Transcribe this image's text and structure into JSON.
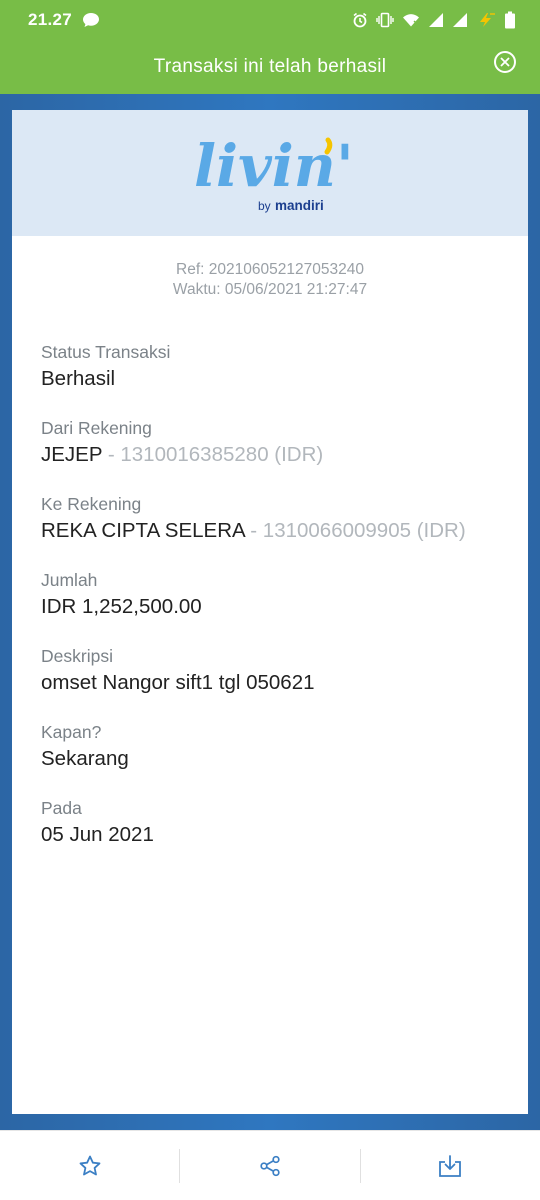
{
  "status_bar": {
    "time": "21.27",
    "icons": [
      "chat-bubble-icon",
      "alarm-icon",
      "vibrate-icon",
      "wifi-icon",
      "signal-icon",
      "signal-icon",
      "battery-saver-icon",
      "battery-icon"
    ]
  },
  "banner": {
    "title": "Transaksi ini telah berhasil",
    "close_icon": "close-circle-icon"
  },
  "logo": {
    "wordmark": "livin'",
    "tagline_by": "by",
    "tagline_brand": "mandiri"
  },
  "receipt": {
    "ref": "Ref: 202106052127053240",
    "waktu": "Waktu: 05/06/2021 21:27:47",
    "fields": [
      {
        "label": "Status Transaksi",
        "value": "Berhasil",
        "sub": ""
      },
      {
        "label": "Dari Rekening",
        "value": "JEJEP",
        "sub": " - 1310016385280 (IDR)"
      },
      {
        "label": "Ke Rekening",
        "value": "REKA CIPTA SELERA",
        "sub": " - 1310066009905 (IDR)"
      },
      {
        "label": "Jumlah",
        "value": "IDR 1,252,500.00",
        "sub": ""
      },
      {
        "label": "Deskripsi",
        "value": "omset Nangor sift1 tgl 050621",
        "sub": ""
      },
      {
        "label": "Kapan?",
        "value": "Sekarang",
        "sub": ""
      },
      {
        "label": "Pada",
        "value": "05 Jun 2021",
        "sub": ""
      }
    ]
  },
  "actions": {
    "icons": [
      "star-icon",
      "share-icon",
      "download-icon"
    ]
  },
  "colors": {
    "banner_green": "#78bd47",
    "frame_blue": "#2f77c0",
    "logo_blue": "#5aa9e6",
    "brand_navy": "#1c3f8f",
    "logo_bg": "#dce8f5",
    "accent_yellow": "#f5c400"
  }
}
